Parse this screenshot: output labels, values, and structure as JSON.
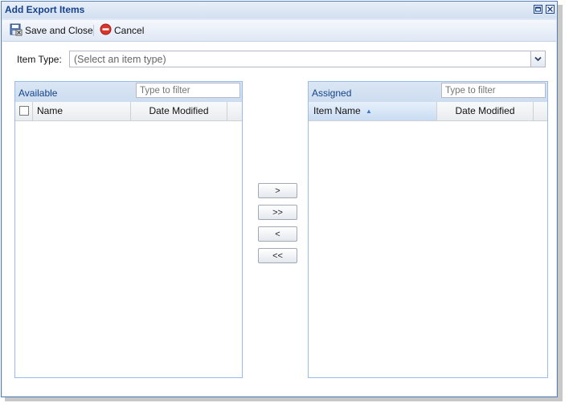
{
  "window": {
    "title": "Add Export Items",
    "restore_icon": "restore-icon",
    "close_icon": "close-icon"
  },
  "toolbar": {
    "save_label": "Save and Close",
    "save_icon": "save-icon",
    "cancel_label": "Cancel",
    "cancel_icon": "cancel-icon"
  },
  "item_type": {
    "label": "Item Type:",
    "placeholder": "(Select an item type)"
  },
  "available": {
    "title": "Available",
    "filter_placeholder": "Type to filter",
    "columns": [
      "Name",
      "Date Modified"
    ]
  },
  "assigned": {
    "title": "Assigned",
    "filter_placeholder": "Type to filter",
    "columns": [
      "Item Name",
      "Date Modified"
    ],
    "sort_indicator": "▲"
  },
  "move_buttons": {
    "add_one": ">",
    "add_all": ">>",
    "remove_one": "<",
    "remove_all": "<<"
  },
  "colors": {
    "title_text": "#15428b",
    "panel_border": "#99bbe8",
    "window_bg": "#dfe8f6",
    "cancel_red": "#d9352b"
  }
}
